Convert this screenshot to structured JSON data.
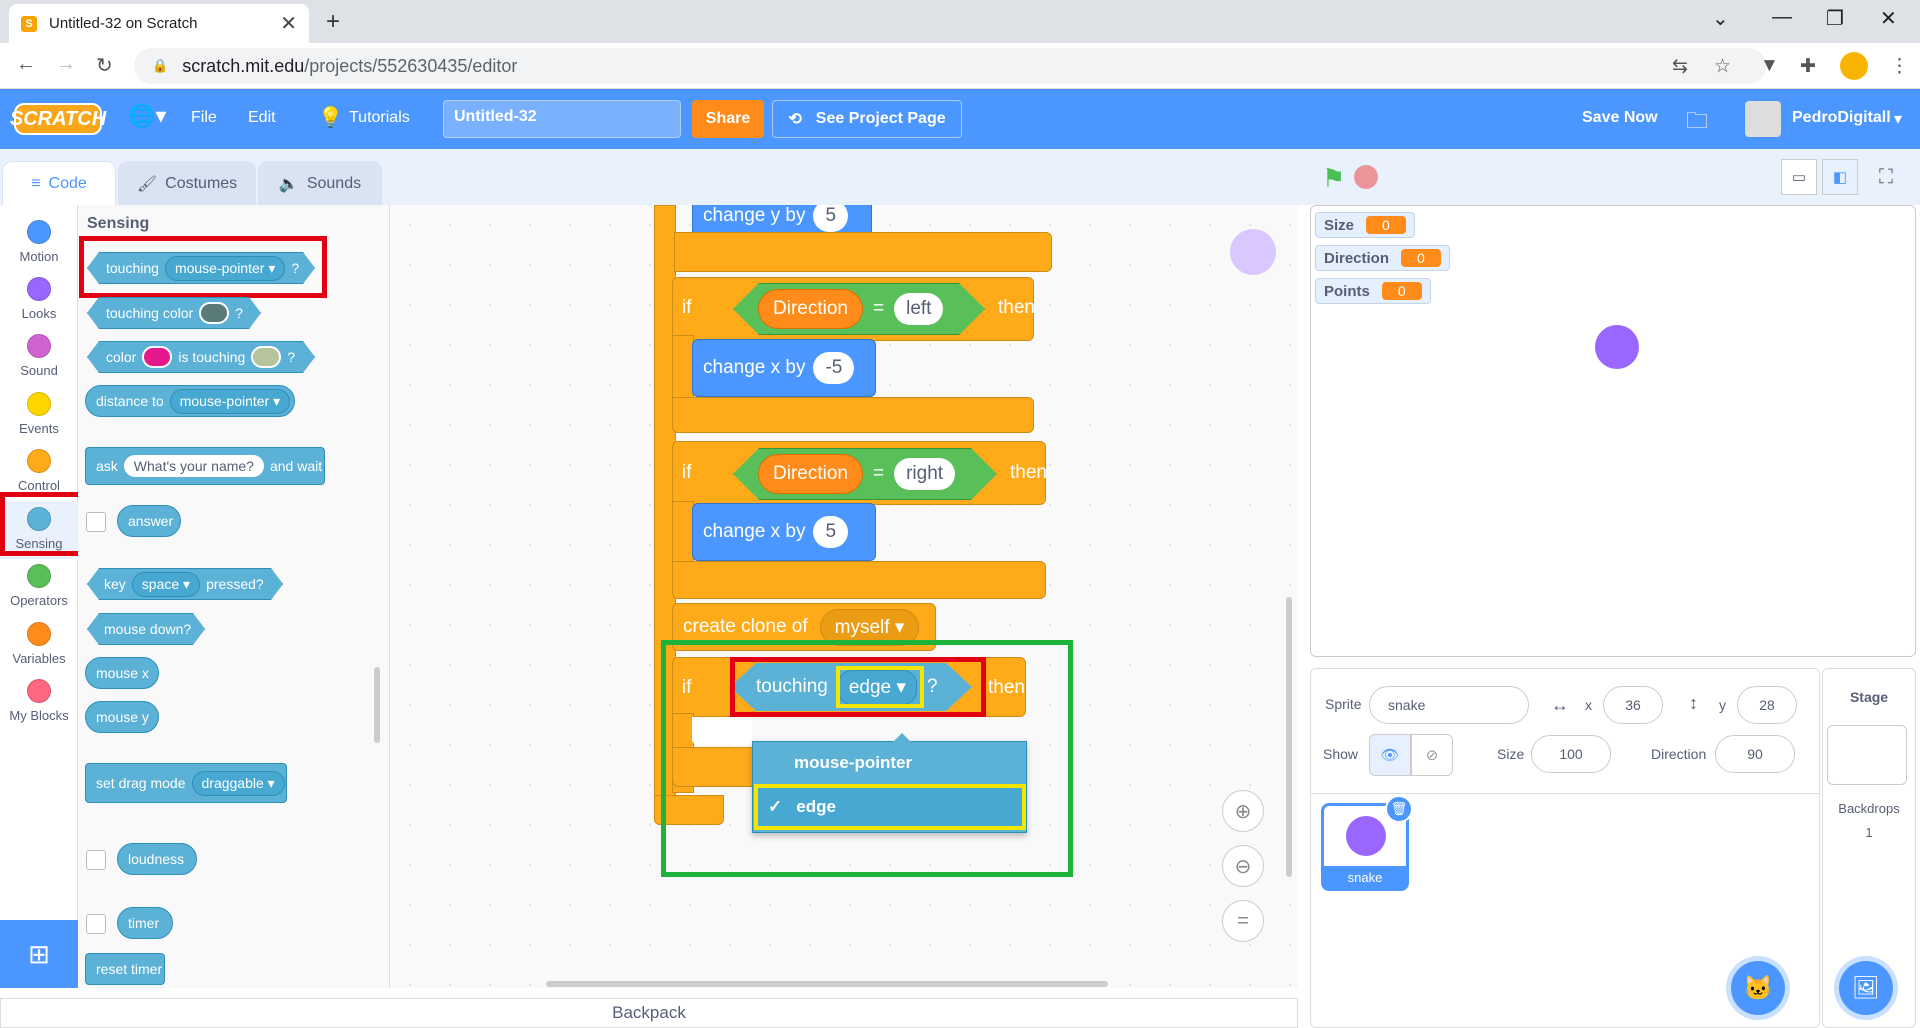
{
  "browser": {
    "tab_title": "Untitled-32 on Scratch",
    "url_host": "scratch.mit.edu",
    "url_path": "/projects/552630435/editor"
  },
  "menubar": {
    "logo": "SCRATCH",
    "file": "File",
    "edit": "Edit",
    "tutorials": "Tutorials",
    "project_title": "Untitled-32",
    "share": "Share",
    "see_project": "See Project Page",
    "save_now": "Save Now",
    "username": "PedroDigitall",
    "accent": "#4c97ff"
  },
  "editor_tabs": [
    "Code",
    "Costumes",
    "Sounds"
  ],
  "categories": [
    {
      "label": "Motion",
      "color": "#4c97ff"
    },
    {
      "label": "Looks",
      "color": "#9966ff"
    },
    {
      "label": "Sound",
      "color": "#cf63cf"
    },
    {
      "label": "Events",
      "color": "#ffd500"
    },
    {
      "label": "Control",
      "color": "#ffab19"
    },
    {
      "label": "Sensing",
      "color": "#5cb1d6"
    },
    {
      "label": "Operators",
      "color": "#59c059"
    },
    {
      "label": "Variables",
      "color": "#ff8c1a"
    },
    {
      "label": "My Blocks",
      "color": "#ff6680"
    }
  ],
  "palette": {
    "heading": "Sensing",
    "touching": "touching",
    "touching_dd": "mouse-pointer",
    "q": "?",
    "touching_color": "touching color",
    "color": "color",
    "is_touching": "is touching",
    "distance_to": "distance to",
    "distance_dd": "mouse-pointer",
    "ask": "ask",
    "ask_default": "What's your name?",
    "and_wait": "and wait",
    "answer": "answer",
    "key": "key",
    "key_dd": "space",
    "pressed": "pressed?",
    "mouse_down": "mouse down?",
    "mouse_x": "mouse x",
    "mouse_y": "mouse y",
    "set_drag": "set drag mode",
    "drag_dd": "draggable",
    "loudness": "loudness",
    "timer": "timer",
    "reset_timer": "reset timer"
  },
  "script": {
    "change_y_partial": "change y by",
    "change_y_val": "5",
    "if1_kw": "if",
    "var_direction": "Direction",
    "eq": "=",
    "left": "left",
    "then": "then",
    "change_x": "change x by",
    "val_neg5": "-5",
    "right": "right",
    "val_5": "5",
    "create_clone": "create clone of",
    "myself": "myself",
    "touching": "touching",
    "edge": "edge",
    "q": "?"
  },
  "dropdown_menu": {
    "options": [
      "mouse-pointer",
      "edge"
    ],
    "selected": "edge",
    "check": "✓"
  },
  "monitors": [
    {
      "name": "Size",
      "value": "0"
    },
    {
      "name": "Direction",
      "value": "0"
    },
    {
      "name": "Points",
      "value": "0"
    }
  ],
  "sprite_info": {
    "sprite_label": "Sprite",
    "sprite_name": "snake",
    "x_label": "x",
    "x": "36",
    "y_label": "y",
    "y": "28",
    "show_label": "Show",
    "size_label": "Size",
    "size": "100",
    "direction_label": "Direction",
    "direction": "90",
    "thumb_name": "snake"
  },
  "stage_panel": {
    "title": "Stage",
    "backdrops_label": "Backdrops",
    "backdrops_count": "1"
  },
  "backpack": "Backpack"
}
